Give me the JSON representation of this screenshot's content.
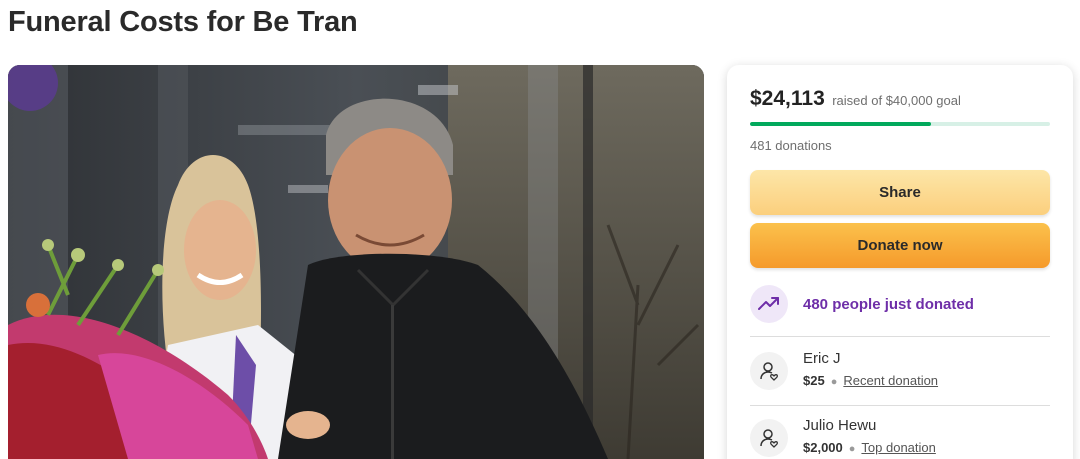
{
  "page": {
    "title": "Funeral Costs for Be Tran"
  },
  "photo": {
    "alt": "Campaign photo"
  },
  "donation_card": {
    "raised_amount": "$24,113",
    "raised_goal_text": "raised of $40,000 goal",
    "progress_fraction": 0.603,
    "donation_count_text": "481 donations",
    "share_label": "Share",
    "donate_label": "Donate now",
    "recent_activity_text": "480 people just donated",
    "donors": [
      {
        "name": "Eric J",
        "amount": "$25",
        "tag": "Recent donation",
        "icon": "donor-avatar-icon"
      },
      {
        "name": "Julio Hewu",
        "amount": "$2,000",
        "tag": "Top donation",
        "icon": "donor-avatar-icon"
      }
    ],
    "colors": {
      "progress_fill": "#02a95c",
      "progress_track": "#d7f0e6",
      "share_button": "#fbcf7d",
      "donate_button": "#f59a2b",
      "recent_activity_text": "#6e2ea8"
    },
    "icons": {
      "recent_activity": "trending-up-icon",
      "donor": "donor-avatar-icon"
    }
  }
}
